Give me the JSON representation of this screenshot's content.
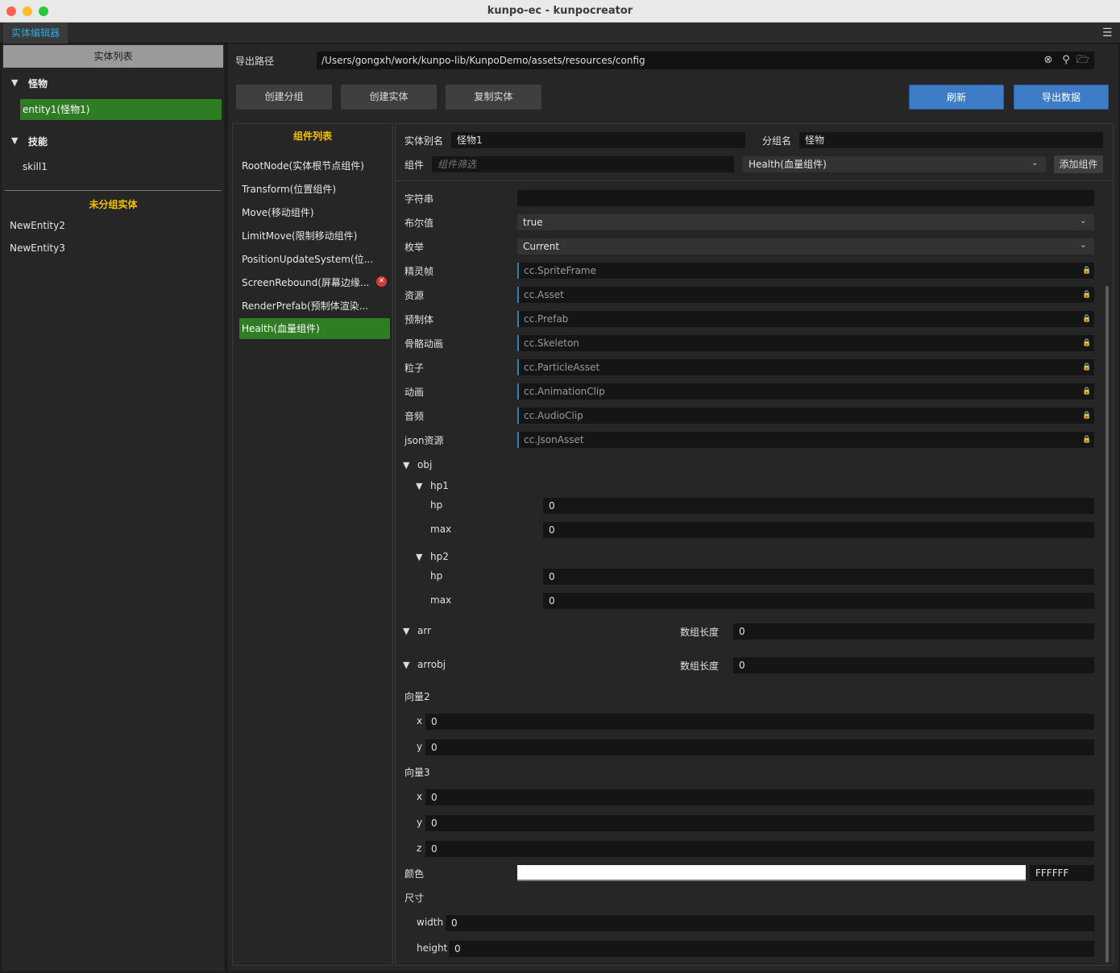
{
  "window": {
    "title": "kunpo-ec - kunpocreator"
  },
  "tabs": [
    {
      "label": "实体编辑器"
    }
  ],
  "left_panel": {
    "header": "实体列表",
    "groups": [
      {
        "label": "怪物",
        "items": [
          "entity1(怪物1)"
        ]
      },
      {
        "label": "技能",
        "items": [
          "skill1"
        ]
      }
    ],
    "ungrouped_title": "未分组实体",
    "ungrouped": [
      "NewEntity2",
      "NewEntity3"
    ]
  },
  "export": {
    "label": "导出路径",
    "path": "/Users/gongxh/work/kunpo-lib/KunpoDemo/assets/resources/config"
  },
  "toolbar": {
    "create_group": "创建分组",
    "create_entity": "创建实体",
    "copy_entity": "复制实体",
    "refresh": "刷新",
    "export_data": "导出数据"
  },
  "components": {
    "title": "组件列表",
    "items": [
      "RootNode(实体根节点组件)",
      "Transform(位置组件)",
      "Move(移动组件)",
      "LimitMove(限制移动组件)",
      "PositionUpdateSystem(位...",
      "ScreenRebound(屏幕边缘...",
      "RenderPrefab(预制体渲染...",
      "Health(血量组件)"
    ],
    "selected": "Health(血量组件)"
  },
  "entity": {
    "alias_label": "实体别名",
    "alias": "怪物1",
    "group_label": "分组名",
    "group": "怪物",
    "component_label": "组件",
    "filter_placeholder": "组件筛选",
    "component_select": "Health(血量组件)",
    "add_component": "添加组件"
  },
  "props": {
    "string_label": "字符串",
    "string_value": "",
    "bool_label": "布尔值",
    "bool_value": "true",
    "enum_label": "枚举",
    "enum_value": "Current",
    "assets": [
      {
        "label": "精灵帧",
        "value": "cc.SpriteFrame"
      },
      {
        "label": "资源",
        "value": "cc.Asset"
      },
      {
        "label": "预制体",
        "value": "cc.Prefab"
      },
      {
        "label": "骨骼动画",
        "value": "cc.Skeleton"
      },
      {
        "label": "粒子",
        "value": "cc.ParticleAsset"
      },
      {
        "label": "动画",
        "value": "cc.AnimationClip"
      },
      {
        "label": "音频",
        "value": "cc.AudioClip"
      },
      {
        "label": "json资源",
        "value": "cc.JsonAsset"
      }
    ],
    "obj": {
      "label": "obj",
      "hp1": {
        "label": "hp1",
        "hp_label": "hp",
        "hp": "0",
        "max_label": "max",
        "max": "0"
      },
      "hp2": {
        "label": "hp2",
        "hp_label": "hp",
        "hp": "0",
        "max_label": "max",
        "max": "0"
      }
    },
    "arr": {
      "label": "arr",
      "len_label": "数组长度",
      "len": "0"
    },
    "arrobj": {
      "label": "arrobj",
      "len_label": "数组长度",
      "len": "0"
    },
    "vec2": {
      "label": "向量2",
      "x_label": "x",
      "x": "0",
      "y_label": "y",
      "y": "0"
    },
    "vec3": {
      "label": "向量3",
      "x_label": "x",
      "x": "0",
      "y_label": "y",
      "y": "0",
      "z_label": "z",
      "z": "0"
    },
    "color": {
      "label": "颜色",
      "hex": "FFFFFF",
      "swatch": "#FFFFFF"
    },
    "size": {
      "label": "尺寸",
      "width_label": "width",
      "width": "0",
      "height_label": "height",
      "height": "0"
    }
  },
  "colors": {
    "accent_green": "#2e7d25",
    "accent_blue": "#3f7cc6",
    "heading_yellow": "#f2c200",
    "tab_blue": "#2ea7e0"
  }
}
